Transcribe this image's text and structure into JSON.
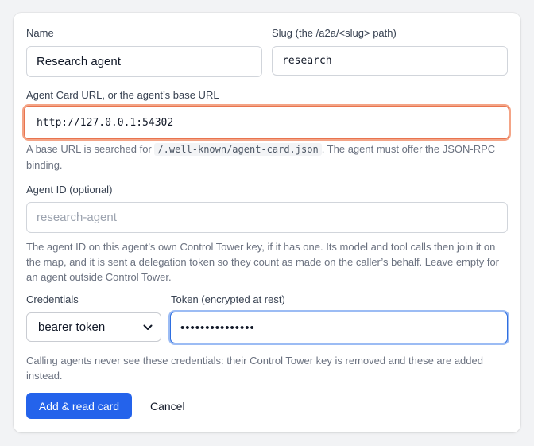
{
  "form": {
    "name": {
      "label": "Name",
      "value": "Research agent"
    },
    "slug": {
      "label": "Slug (the /a2a/<slug> path)",
      "value": "research"
    },
    "agent_card_url": {
      "label": "Agent Card URL, or the agent’s base URL",
      "value": "http://127.0.0.1:54302",
      "help_prefix": "A base URL is searched for ",
      "help_code": "/.well-known/agent-card.json",
      "help_suffix": ". The agent must offer the JSON-RPC binding."
    },
    "agent_id": {
      "label": "Agent ID (optional)",
      "placeholder": "research-agent",
      "help": "The agent ID on this agent’s own Control Tower key, if it has one. Its model and tool calls then join it on the map, and it is sent a delegation token so they count as made on the caller’s behalf. Leave empty for an agent outside Control Tower."
    },
    "credentials": {
      "label": "Credentials",
      "selected": "bearer token"
    },
    "token": {
      "label": "Token (encrypted at rest)",
      "masked_value": "•••••••••••••••"
    },
    "credentials_help": "Calling agents never see these credentials: their Control Tower key is removed and these are added instead."
  },
  "actions": {
    "submit_label": "Add & read card",
    "cancel_label": "Cancel"
  },
  "colors": {
    "primary": "#2463eb",
    "focus_orange": "#e8744f",
    "focus_blue": "#2f6fe0"
  }
}
